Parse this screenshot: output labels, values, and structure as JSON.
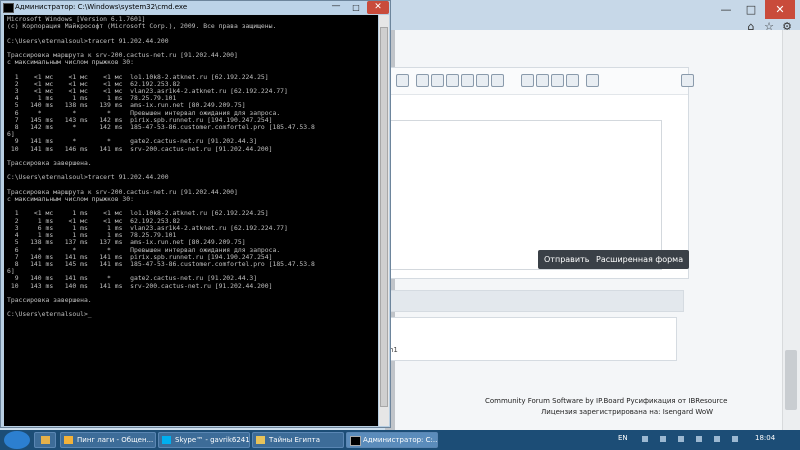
{
  "cmd": {
    "title": "Администратор: C:\\Windows\\system32\\cmd.exe",
    "lines": [
      "Microsoft Windows [Version 6.1.7601]",
      "(c) Корпорация Майкрософт (Microsoft Corp.), 2009. Все права защищены.",
      "",
      "C:\\Users\\eternalsoul>tracert 91.202.44.200",
      "",
      "Трассировка маршрута к srv-200.cactus-net.ru [91.202.44.200]",
      "с максимальным числом прыжков 30:",
      "",
      "  1    <1 мс    <1 мс    <1 мс  lo1.10k8-2.atknet.ru [62.192.224.25]",
      "  2    <1 мс    <1 мс    <1 мс  62.192.253.82",
      "  3    <1 мс    <1 мс    <1 мс  vlan23.asr1k4-2.atknet.ru [62.192.224.77]",
      "  4     1 ms     1 ms     1 ms  78.25.79.101",
      "  5   140 ms   138 ms   139 ms  ams-ix.run.net [80.249.209.75]",
      "  6     *        *        *     Превышен интервал ожидания для запроса.",
      "  7   145 ms   143 ms   142 ms  pirix.spb.runnet.ru [194.190.247.254]",
      "  8   142 ms     *      142 ms  185-47-53-86.customer.comfortel.pro [185.47.53.8",
      "6]",
      "  9   141 ms     *        *     gate2.cactus-net.ru [91.202.44.3]",
      " 10   141 ms   146 ms   141 ms  srv-200.cactus-net.ru [91.202.44.200]",
      "",
      "Трассировка завершена.",
      "",
      "C:\\Users\\eternalsoul>tracert 91.202.44.200",
      "",
      "Трассировка маршрута к srv-200.cactus-net.ru [91.202.44.200]",
      "с максимальным числом прыжков 30:",
      "",
      "  1    <1 мс     1 ms    <1 мс  lo1.10k8-2.atknet.ru [62.192.224.25]",
      "  2     1 ms    <1 мс    <1 мс  62.192.253.82",
      "  3     6 ms     1 ms     1 ms  vlan23.asr1k4-2.atknet.ru [62.192.224.77]",
      "  4     1 ms     1 ms     1 ms  78.25.79.101",
      "  5   138 ms   137 ms   137 ms  ams-ix.run.net [80.249.209.75]",
      "  6     *        *        *     Превышен интервал ожидания для запроса.",
      "  7   140 ms   141 ms   141 ms  pirix.spb.runnet.ru [194.190.247.254]",
      "  8   141 ms   145 ms   141 ms  185-47-53-86.customer.comfortel.pro [185.47.53.8",
      "6]",
      "  9   140 ms   141 ms     *     gate2.cactus-net.ru [91.202.44.3]",
      " 10   143 ms   140 ms   141 ms  srv-200.cactus-net.ru [91.202.44.200]",
      "",
      "Трассировка завершена.",
      "",
      "C:\\Users\\eternalsoul>_"
    ]
  },
  "browser": {
    "send_button": "Отправить",
    "advanced_button": "Расширенная форма",
    "fragment_text": "h1",
    "footer_line1": "Community Forum Software by IP.Board Русификация от IBResource",
    "footer_line2": "Лицензия зарегистрирована на: Isengard WoW"
  },
  "taskbar": {
    "apps": [
      {
        "label": "Пинг лаги - Общен...",
        "color": "#f3b23a"
      },
      {
        "label": "Skype™ - gavrik624104",
        "color": "#00aff0"
      },
      {
        "label": "Тайны Египта",
        "color": "#e6c25a"
      },
      {
        "label": "Администратор: C:...",
        "color": "#000000"
      }
    ],
    "lang": "EN",
    "clock": "18:04"
  }
}
